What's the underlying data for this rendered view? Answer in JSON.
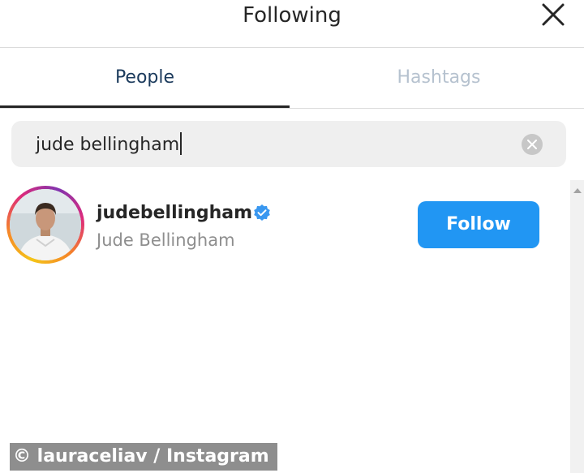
{
  "header": {
    "title": "Following",
    "close_icon": "close-icon"
  },
  "tabs": [
    {
      "label": "People",
      "active": true
    },
    {
      "label": "Hashtags",
      "active": false
    }
  ],
  "search": {
    "value": "jude bellingham",
    "clear_icon": "clear-circle-icon"
  },
  "results": [
    {
      "username": "judebellingham",
      "full_name": "Jude Bellingham",
      "verified": true,
      "button_label": "Follow"
    }
  ],
  "watermark": "© lauraceliav / Instagram",
  "colors": {
    "accent": "#2196f3",
    "active_tab_text": "#1b3a5c",
    "inactive_tab_text": "#b6c2cf",
    "secondary_text": "#8e8e8e"
  }
}
